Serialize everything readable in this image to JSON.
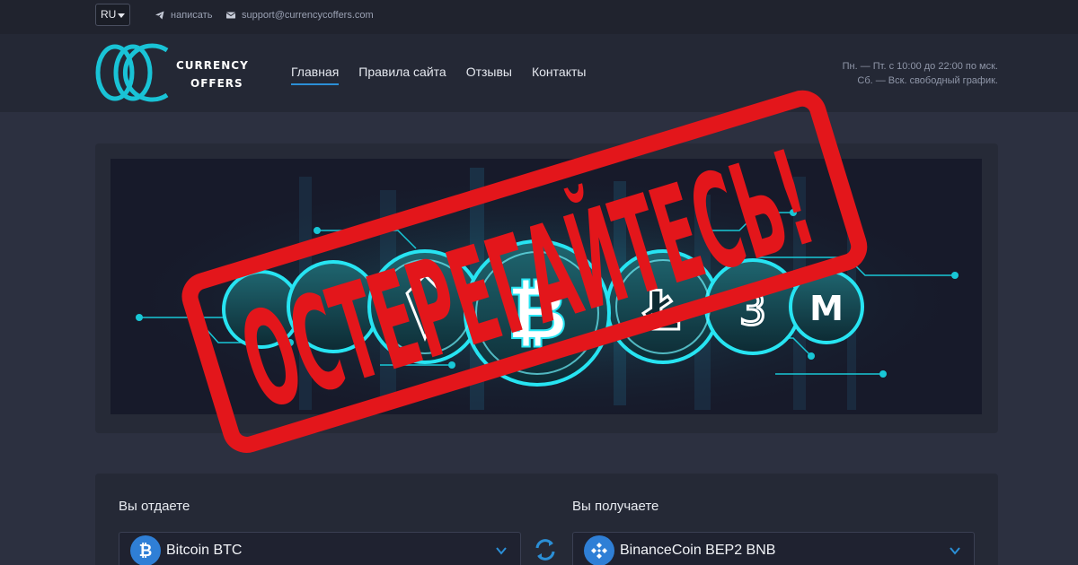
{
  "topbar": {
    "lang": "RU",
    "write_label": "написать",
    "email": "support@currencycoffers.com"
  },
  "logo": {
    "line1": "CURRENCY",
    "line2": "OFFERS"
  },
  "nav": {
    "items": [
      {
        "label": "Главная",
        "active": true
      },
      {
        "label": "Правила сайта",
        "active": false
      },
      {
        "label": "Отзывы",
        "active": false
      },
      {
        "label": "Контакты",
        "active": false
      }
    ]
  },
  "hours": {
    "line1": "Пн. — Пт. с 10:00 до 22:00 по мск.",
    "line2": "Сб. — Вск. свободный график."
  },
  "exchange": {
    "give_label": "Вы отдаете",
    "get_label": "Вы получаете",
    "give_currency": "Bitcoin BTC",
    "get_currency": "BinanceCoin BEP2 BNB"
  },
  "stamp": {
    "text": "ОСТЕРЕГАЙТЕСЬ!",
    "color": "#e3161b"
  },
  "colors": {
    "accent": "#2b8fd6",
    "neon": "#19d3e6",
    "bitcoin": "#2f7fd6",
    "binance": "#2f7fd6"
  }
}
